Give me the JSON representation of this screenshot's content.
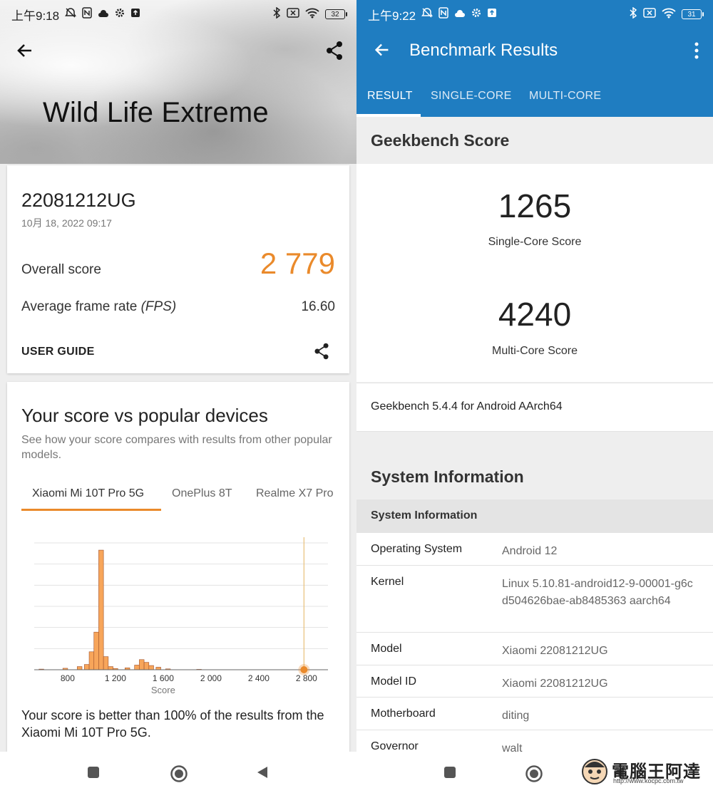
{
  "left": {
    "status": {
      "time": "上午9:18",
      "battery": "32"
    },
    "hero_title": "Wild Life Extreme",
    "result": {
      "device": "22081212UG",
      "date": "10月 18, 2022 09:17",
      "overall_label": "Overall score",
      "overall_value": "2 779",
      "fps_label": "Average frame rate",
      "fps_unit": "(FPS)",
      "fps_value": "16.60",
      "user_guide": "USER GUIDE"
    },
    "compare": {
      "title": "Your score vs popular devices",
      "description": "See how your score compares with results from other popular models.",
      "tabs": [
        "Xiaomi Mi 10T Pro 5G",
        "OnePlus 8T",
        "Realme X7 Pro"
      ],
      "active_tab": 0,
      "result_text": "Your score is better than 100% of the results from the Xiaomi Mi 10T Pro 5G."
    },
    "colors": {
      "accent": "#ea8a2b",
      "bar_fill": "#f7a55a"
    }
  },
  "chart_data": {
    "type": "bar",
    "title": "",
    "xlabel": "Score",
    "ylabel": "",
    "xlim": [
      520,
      2980
    ],
    "x_ticks": [
      800,
      1200,
      1600,
      2000,
      2400,
      2800
    ],
    "x_tick_labels": [
      "800",
      "1 200",
      "1 600",
      "2 000",
      "2 400",
      "2 800"
    ],
    "grid": true,
    "bins": [
      {
        "x": 580,
        "value": 0.3
      },
      {
        "x": 780,
        "value": 0.7
      },
      {
        "x": 900,
        "value": 1.5
      },
      {
        "x": 960,
        "value": 2.5
      },
      {
        "x": 1000,
        "value": 8.5
      },
      {
        "x": 1040,
        "value": 17.8
      },
      {
        "x": 1080,
        "value": 56.6
      },
      {
        "x": 1120,
        "value": 6.2
      },
      {
        "x": 1160,
        "value": 1.5
      },
      {
        "x": 1200,
        "value": 0.6
      },
      {
        "x": 1300,
        "value": 0.9
      },
      {
        "x": 1380,
        "value": 2.2
      },
      {
        "x": 1420,
        "value": 4.8
      },
      {
        "x": 1460,
        "value": 3.5
      },
      {
        "x": 1500,
        "value": 2.0
      },
      {
        "x": 1560,
        "value": 1.2
      },
      {
        "x": 1640,
        "value": 0.4
      },
      {
        "x": 1900,
        "value": 0.2
      }
    ],
    "your_score": 2779
  },
  "right": {
    "status": {
      "time": "上午9:22",
      "battery": "31"
    },
    "title": "Benchmark Results",
    "tabs": [
      "RESULT",
      "SINGLE-CORE",
      "MULTI-CORE"
    ],
    "active_tab": 0,
    "score_section": "Geekbench Score",
    "single_core_score": "1265",
    "single_core_label": "Single-Core Score",
    "multi_core_score": "4240",
    "multi_core_label": "Multi-Core Score",
    "version": "Geekbench 5.4.4 for Android AArch64",
    "sysinfo_title": "System Information",
    "sysinfo_subheader": "System Information",
    "sysinfo": [
      {
        "key": "Operating System",
        "value": "Android 12"
      },
      {
        "key": "Kernel",
        "value": "Linux 5.10.81-android12-9-00001-g6cd504626bae-ab8485363 aarch64"
      },
      {
        "key": "Model",
        "value": "Xiaomi 22081212UG"
      },
      {
        "key": "Model ID",
        "value": "Xiaomi 22081212UG"
      },
      {
        "key": "Motherboard",
        "value": "diting"
      },
      {
        "key": "Governor",
        "value": "walt"
      }
    ],
    "colors": {
      "app_bar": "#1f7dc1"
    }
  },
  "watermark": {
    "text": "電腦王阿達",
    "url": "http://www.kocpc.com.tw"
  }
}
